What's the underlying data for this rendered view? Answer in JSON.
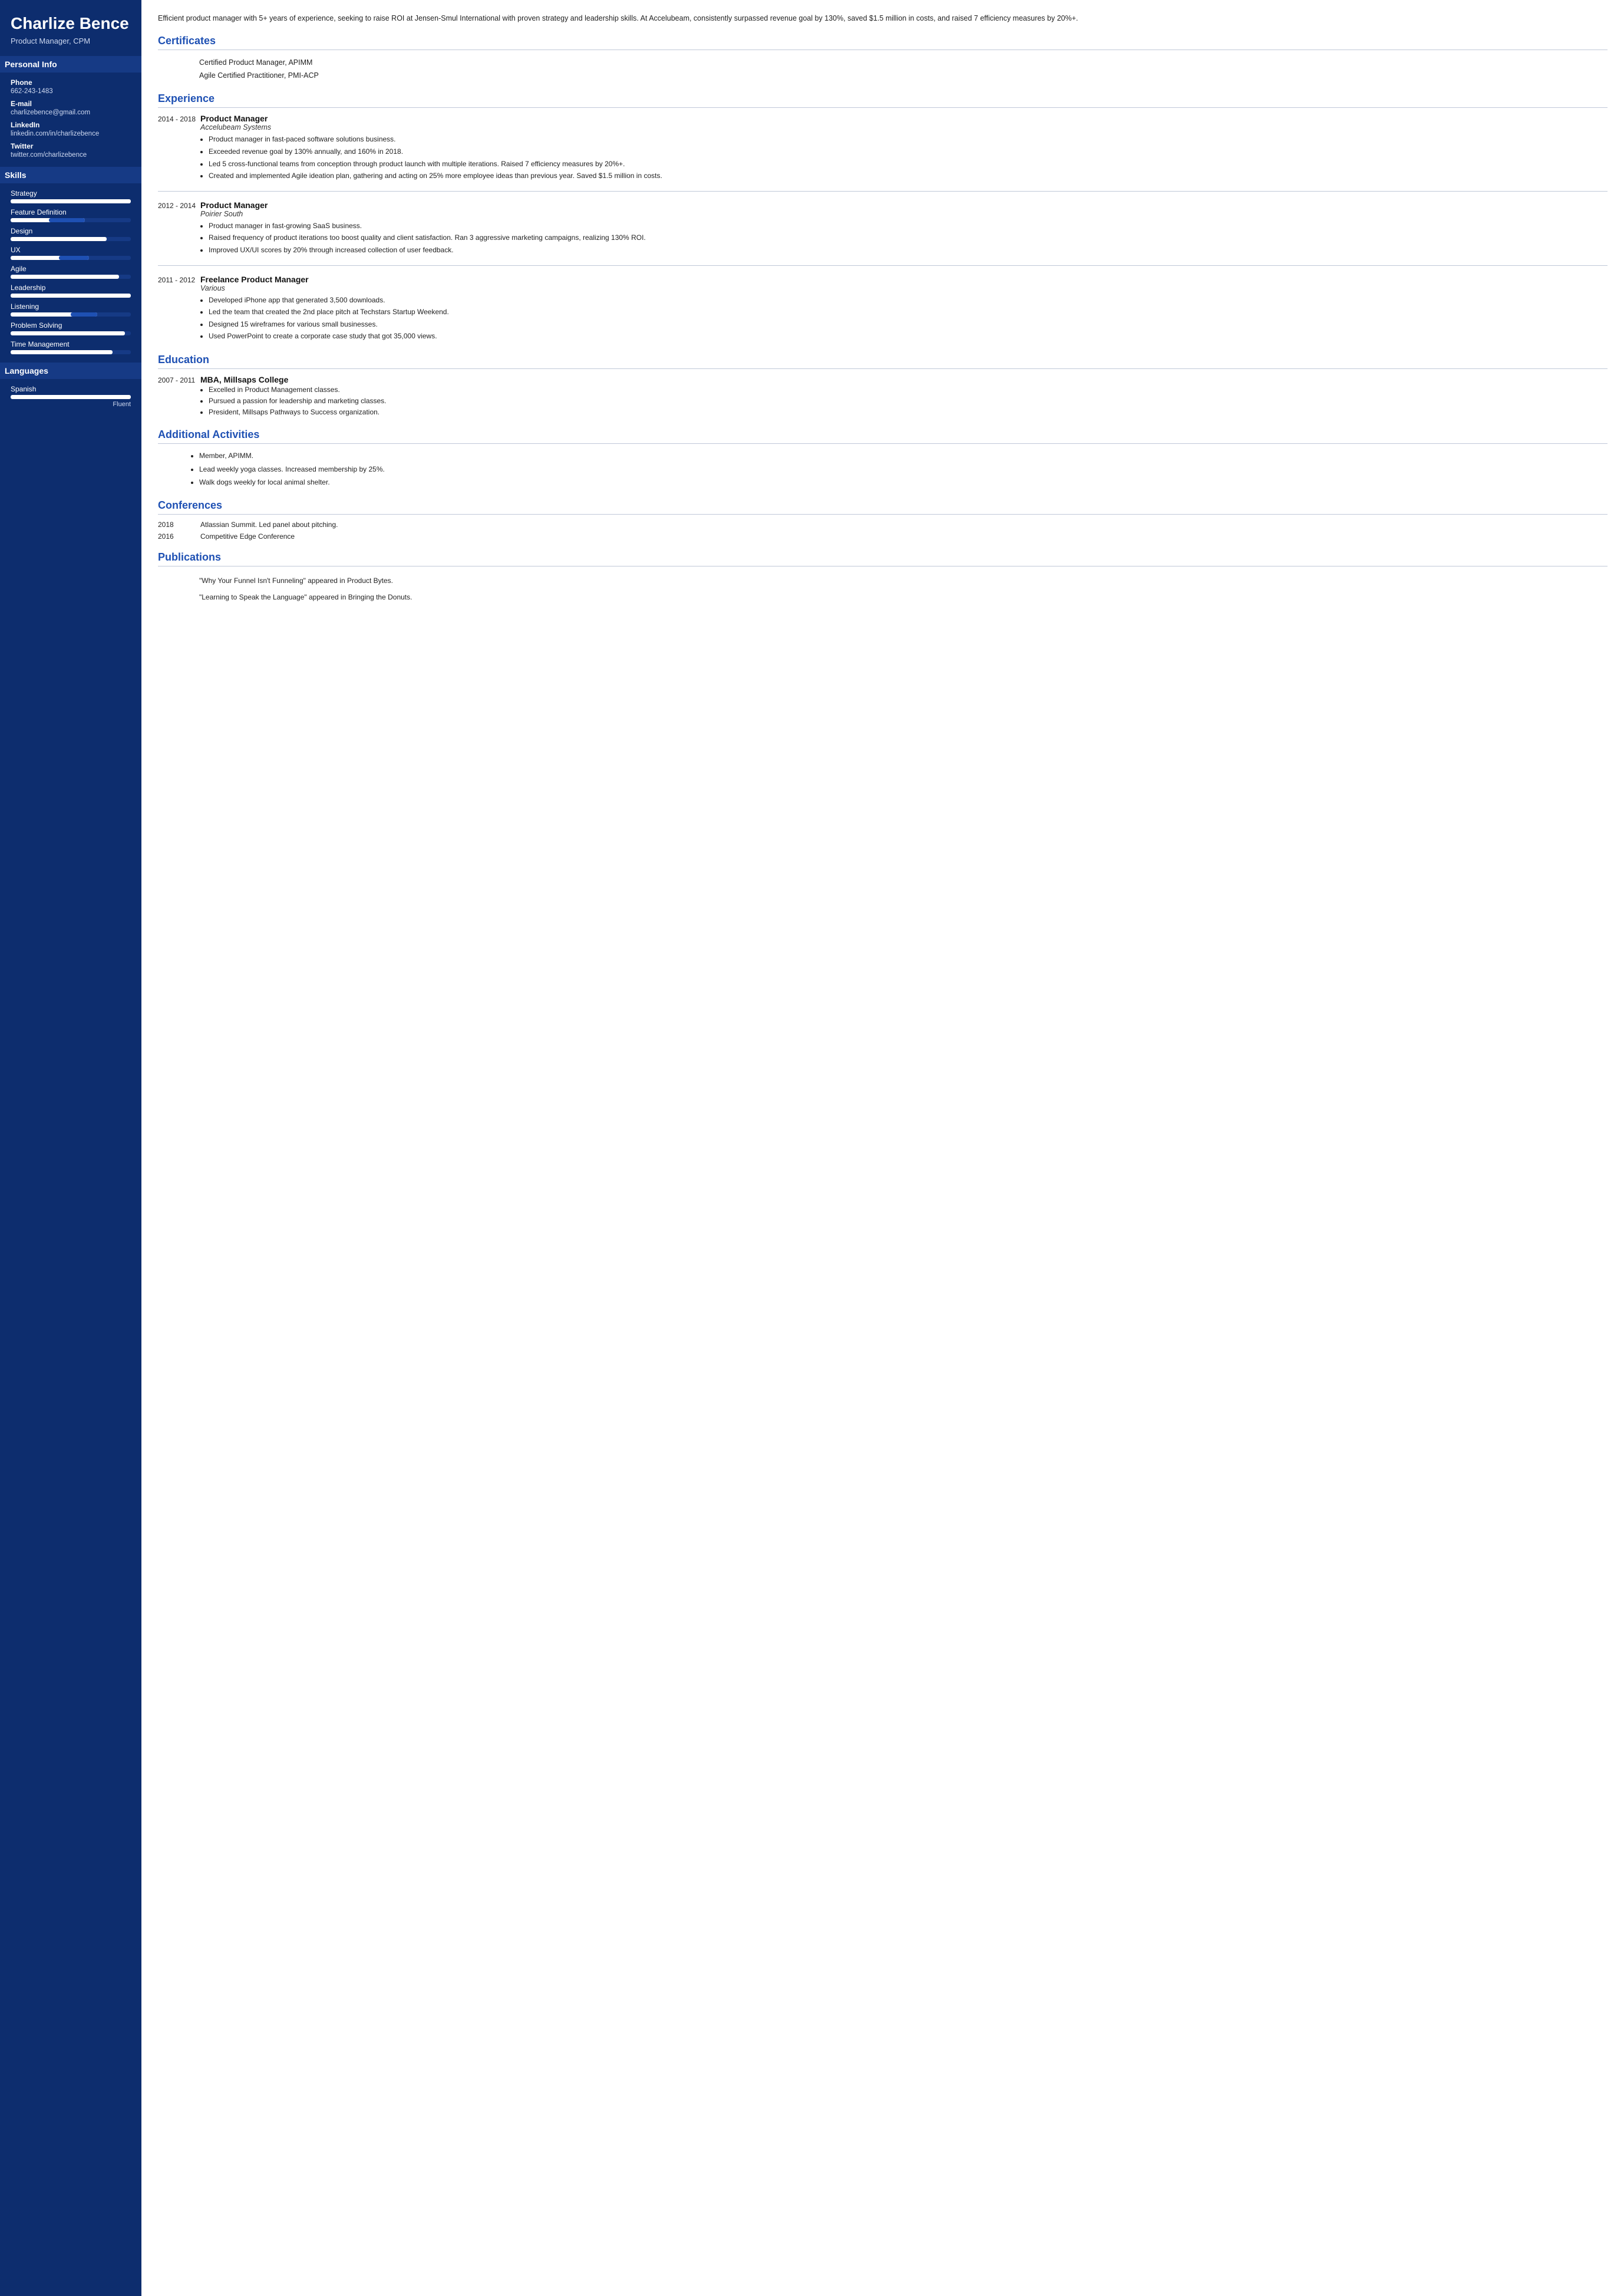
{
  "sidebar": {
    "name": "Charlize Bence",
    "title": "Product Manager, CPM",
    "personal_info_header": "Personal Info",
    "fields": [
      {
        "label": "Phone",
        "value": "662-243-1483"
      },
      {
        "label": "E-mail",
        "value": "charlizebence@gmail.com"
      },
      {
        "label": "LinkedIn",
        "value": "linkedin.com/in/charlizebence"
      },
      {
        "label": "Twitter",
        "value": "twitter.com/charlizebence"
      }
    ],
    "skills_header": "Skills",
    "skills": [
      {
        "name": "Strategy",
        "fill_pct": 100,
        "accent_pct": 0
      },
      {
        "name": "Feature Definition",
        "fill_pct": 62,
        "accent_pct": 30
      },
      {
        "name": "Design",
        "fill_pct": 80,
        "accent_pct": 0
      },
      {
        "name": "UX",
        "fill_pct": 65,
        "accent_pct": 25
      },
      {
        "name": "Agile",
        "fill_pct": 90,
        "accent_pct": 0
      },
      {
        "name": "Leadership",
        "fill_pct": 100,
        "accent_pct": 0
      },
      {
        "name": "Listening",
        "fill_pct": 72,
        "accent_pct": 22
      },
      {
        "name": "Problem Solving",
        "fill_pct": 95,
        "accent_pct": 0
      },
      {
        "name": "Time Management",
        "fill_pct": 85,
        "accent_pct": 0
      }
    ],
    "languages_header": "Languages",
    "languages": [
      {
        "name": "Spanish",
        "fill_pct": 100,
        "level": "Fluent"
      }
    ]
  },
  "main": {
    "summary": "Efficient product manager with 5+ years of experience, seeking to raise ROI at Jensen-Smul International with proven strategy and leadership skills. At Accelubeam, consistently surpassed revenue goal by 130%, saved $1.5 million in costs, and raised 7 efficiency measures by 20%+.",
    "certificates_title": "Certificates",
    "certificates": [
      "Certified Product Manager, APIMM",
      "Agile Certified Practitioner, PMI-ACP"
    ],
    "experience_title": "Experience",
    "experiences": [
      {
        "dates": "2014 - 2018",
        "title": "Product Manager",
        "company": "Accelubeam Systems",
        "bullets": [
          "Product manager in fast-paced software solutions business.",
          "Exceeded revenue goal by 130% annually, and 160% in 2018.",
          "Led 5 cross-functional teams from conception through product launch with multiple iterations. Raised 7 efficiency measures by 20%+.",
          "Created and implemented Agile ideation plan, gathering and acting on 25% more employee ideas than previous year. Saved $1.5 million in costs."
        ]
      },
      {
        "dates": "2012 - 2014",
        "title": "Product Manager",
        "company": "Poirier South",
        "bullets": [
          "Product manager in fast-growing SaaS business.",
          "Raised frequency of product iterations too boost quality and client satisfaction. Ran 3 aggressive marketing campaigns, realizing 130% ROI.",
          "Improved UX/UI scores by 20% through increased collection of user feedback."
        ]
      },
      {
        "dates": "2011 - 2012",
        "title": "Freelance Product Manager",
        "company": "Various",
        "bullets": [
          "Developed iPhone app that generated 3,500 downloads.",
          "Led the team that created the 2nd place pitch at Techstars Startup Weekend.",
          "Designed 15 wireframes for various small businesses.",
          "Used PowerPoint to create a corporate case study that got 35,000 views."
        ]
      }
    ],
    "education_title": "Education",
    "educations": [
      {
        "dates": "2007 - 2011",
        "degree": "MBA, Millsaps College",
        "bullets": [
          "Excelled in Product Management classes.",
          "Pursued a passion for leadership and marketing classes.",
          "President, Millsaps Pathways to Success organization."
        ]
      }
    ],
    "activities_title": "Additional Activities",
    "activities": [
      "Member, APIMM.",
      "Lead weekly yoga classes. Increased membership by 25%.",
      "Walk dogs weekly for local animal shelter."
    ],
    "conferences_title": "Conferences",
    "conferences": [
      {
        "year": "2018",
        "desc": "Atlassian Summit. Led panel about pitching."
      },
      {
        "year": "2016",
        "desc": "Competitive Edge Conference"
      }
    ],
    "publications_title": "Publications",
    "publications": [
      "\"Why Your Funnel Isn't Funneling\" appeared in Product Bytes.",
      "\"Learning to Speak the Language\" appeared in Bringing the Donuts."
    ]
  }
}
